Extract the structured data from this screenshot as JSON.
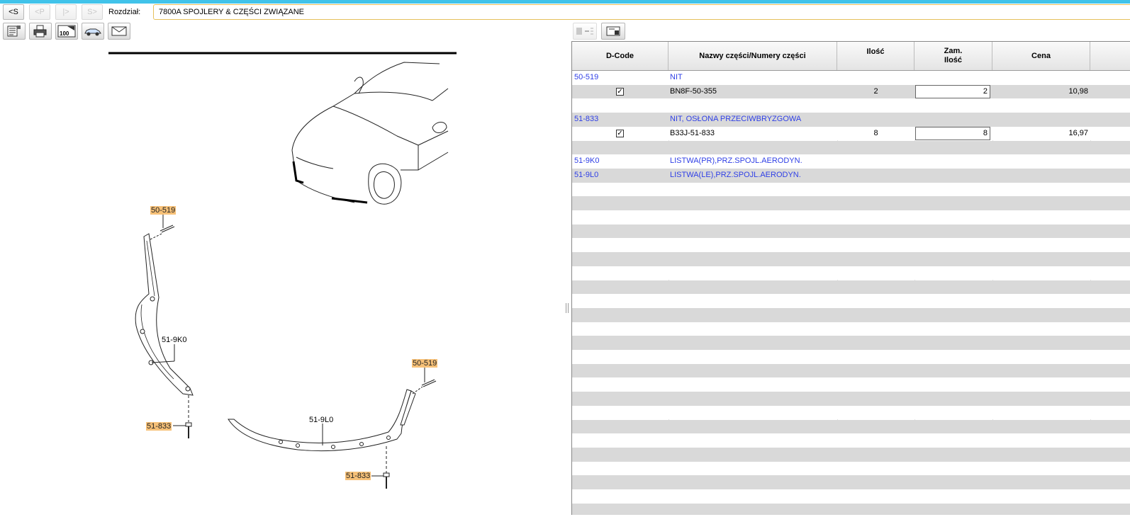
{
  "nav": {
    "back_label": "<S",
    "prev_label": "<P",
    "next_label": "|>",
    "last_label": "S>"
  },
  "section": {
    "label": "Rozdział:",
    "value": "7800A  SPOJLERY & CZĘŚCI ZWIĄZANE"
  },
  "toolbar": {
    "icons": [
      "parts-list-icon",
      "print-icon",
      "zoom-100-icon",
      "vehicle-icon",
      "mail-icon"
    ],
    "zoom_text": "100"
  },
  "diagram": {
    "callouts": [
      {
        "id": "c1",
        "text": "50-519",
        "highlight": true
      },
      {
        "id": "c2",
        "text": "51-9K0",
        "highlight": false
      },
      {
        "id": "c3",
        "text": "51-833",
        "highlight": true
      },
      {
        "id": "c4",
        "text": "50-519",
        "highlight": true
      },
      {
        "id": "c5",
        "text": "51-9L0",
        "highlight": false
      },
      {
        "id": "c6",
        "text": "51-833",
        "highlight": true
      }
    ]
  },
  "table_toolbar": {
    "icons": [
      "add-to-cart-icon",
      "export-icon"
    ]
  },
  "table": {
    "columns": [
      "D-Code",
      "Nazwy części/Numery części",
      "Ilość",
      "Zam.\nIlość",
      "Cena"
    ],
    "rows": [
      {
        "type": "group",
        "dcode": "50-519",
        "name": "NIT"
      },
      {
        "type": "part",
        "checked": true,
        "number": "BN8F-50-355",
        "qty": "2",
        "order_qty": "2",
        "price": "10,98"
      },
      {
        "type": "blank"
      },
      {
        "type": "group",
        "dcode": "51-833",
        "name": "NIT, OSŁONA PRZECIWBRYZGOWA"
      },
      {
        "type": "part",
        "checked": true,
        "number": "B33J-51-833",
        "qty": "8",
        "order_qty": "8",
        "price": "16,97"
      },
      {
        "type": "blank"
      },
      {
        "type": "group",
        "dcode": "51-9K0",
        "name": "LISTWA(PR),PRZ.SPOJL.AERODYN."
      },
      {
        "type": "group",
        "dcode": "51-9L0",
        "name": "LISTWA(LE),PRZ.SPOJL.AERODYN."
      }
    ],
    "checkmark": "✓",
    "colors": {
      "link": "#2f3fe6",
      "stripe": "#d9d9d9",
      "highlight": "#f7c178"
    }
  }
}
